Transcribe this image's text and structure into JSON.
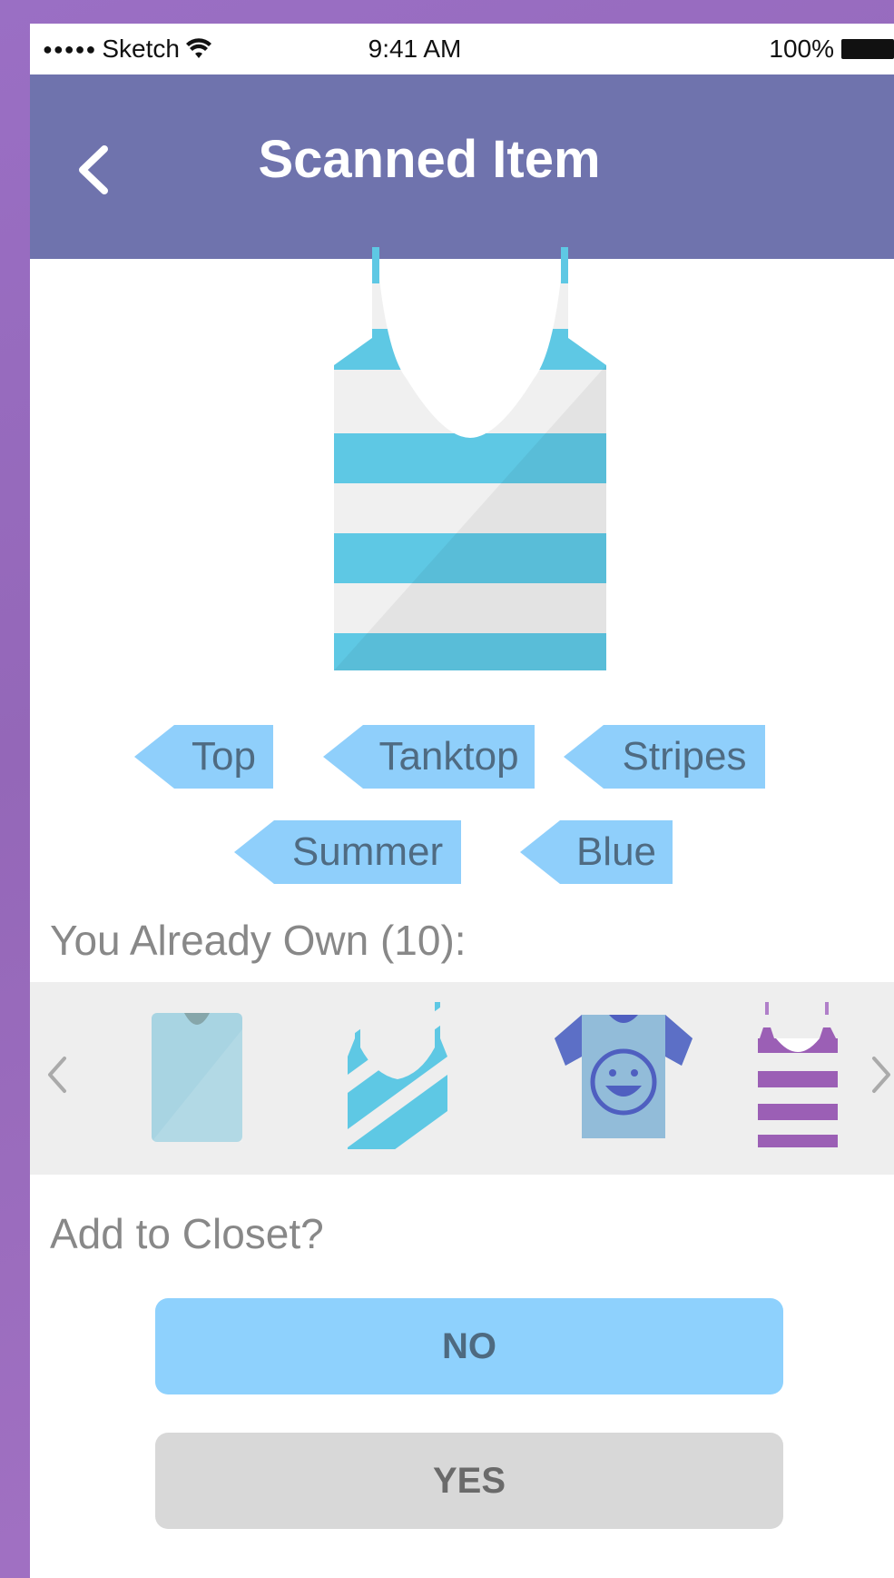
{
  "status_bar": {
    "signal": "●●●●●",
    "carrier": "Sketch",
    "time": "9:41 AM",
    "battery": "100%"
  },
  "header": {
    "back_icon": "chevron-left-icon",
    "title": "Scanned Item"
  },
  "item": {
    "image": "striped-tanktop-icon",
    "colors": [
      "#5ec8e4",
      "#f0f0f0"
    ]
  },
  "tags": [
    {
      "label": "Top"
    },
    {
      "label": "Tanktop"
    },
    {
      "label": "Stripes"
    },
    {
      "label": "Summer"
    },
    {
      "label": "Blue"
    }
  ],
  "owned": {
    "label": "You Already Own (10):",
    "items": [
      {
        "icon": "light-blue-tee-icon"
      },
      {
        "icon": "diagonal-stripe-tanktop-icon"
      },
      {
        "icon": "smiley-tee-icon"
      },
      {
        "icon": "purple-stripe-tanktop-icon"
      }
    ],
    "prev_icon": "chevron-left-icon",
    "next_icon": "chevron-right-icon"
  },
  "closet": {
    "label": "Add to Closet?",
    "no_label": "NO",
    "yes_label": "YES"
  },
  "colors": {
    "nav": "#6f73ad",
    "tag": "#8fcffb",
    "no_button": "#8ed1fd",
    "yes_button": "#d8d8d8"
  }
}
